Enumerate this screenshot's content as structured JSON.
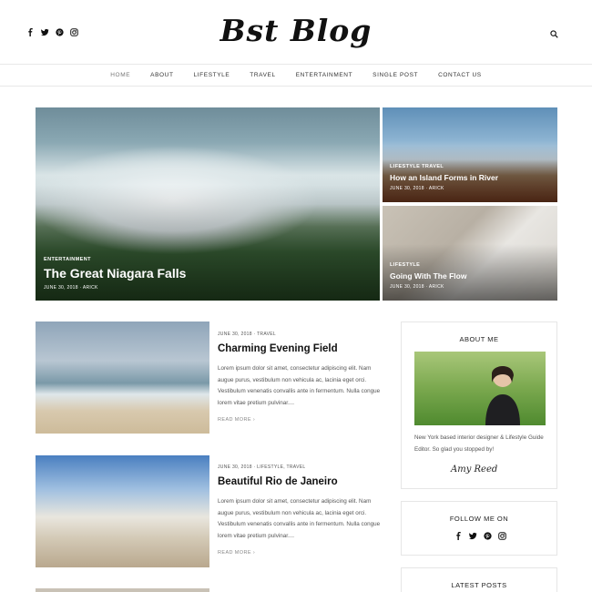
{
  "header": {
    "logo": "Bst Blog",
    "social_icons": [
      "facebook-icon",
      "twitter-icon",
      "pinterest-icon",
      "instagram-icon"
    ],
    "search_icon": "search-icon"
  },
  "nav": {
    "items": [
      "HOME",
      "ABOUT",
      "LIFESTYLE",
      "TRAVEL",
      "ENTERTAINMENT",
      "SINGLE POST",
      "CONTACT US"
    ]
  },
  "hero": [
    {
      "category": "ENTERTAINMENT",
      "title": "The Great Niagara Falls",
      "meta": "JUNE 30, 2018 · ARICK"
    },
    {
      "category": "LIFESTYLE  TRAVEL",
      "title": "How an Island Forms in River",
      "meta": "JUNE 30, 2018 · ARICK"
    },
    {
      "category": "LIFESTYLE",
      "title": "Going With The Flow",
      "meta": "JUNE 30, 2018 · ARICK"
    }
  ],
  "posts": [
    {
      "meta": "JUNE 30, 2018 · TRAVEL",
      "title": "Charming Evening Field",
      "excerpt": "Lorem ipsum dolor sit amet, consectetur adipiscing elit. Nam augue purus, vestibulum non vehicula ac, lacinia eget orci. Vestibulum venenatis convallis ante in fermentum. Nulla congue lorem vitae pretium pulvinar....",
      "read_more": "READ MORE"
    },
    {
      "meta": "JUNE 30, 2018 · LIFESTYLE, TRAVEL",
      "title": "Beautiful Rio de Janeiro",
      "excerpt": "Lorem ipsum dolor sit amet, consectetur adipiscing elit. Nam augue purus, vestibulum non vehicula ac, lacinia eget orci. Vestibulum venenatis convallis ante in fermentum. Nulla congue lorem vitae pretium pulvinar....",
      "read_more": "READ MORE"
    }
  ],
  "sidebar": {
    "about_title": "ABOUT ME",
    "about_text": "New York based interior designer & Lifestyle Guide Editor. So glad you stopped by!",
    "signature": "Amy Reed",
    "follow_title": "FOLLOW ME ON",
    "latest_title": "LATEST POSTS"
  }
}
